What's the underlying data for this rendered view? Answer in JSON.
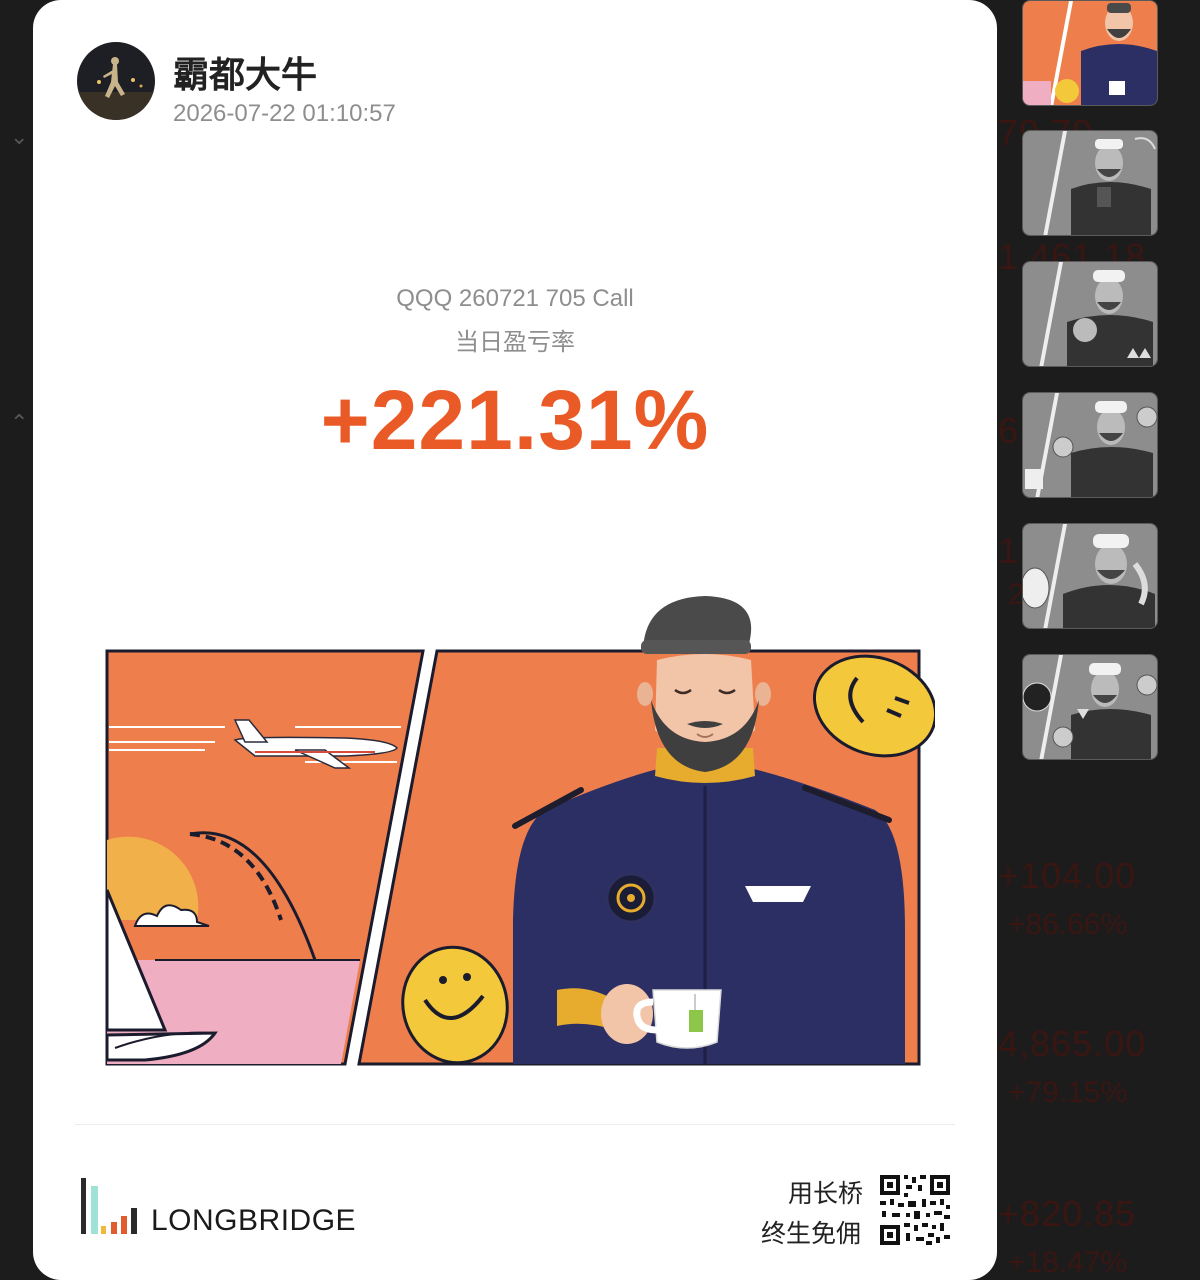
{
  "background": {
    "rows": [
      {
        "value": "79.79",
        "pct": ""
      },
      {
        "value": "1,461.18",
        "pct": ""
      },
      {
        "value": "6,",
        "pct": ""
      },
      {
        "value": "1,",
        "pct": "2"
      },
      {
        "value": "+104.00",
        "pct": "+86.66%"
      },
      {
        "value": "4,865.00",
        "pct": "+79.15%"
      },
      {
        "value": "+820.85",
        "pct": "+18.47%"
      }
    ]
  },
  "card": {
    "username": "霸都大牛",
    "timestamp": "2026-07-22 01:10:57",
    "contract": "QQQ 260721 705 Call",
    "metric_label": "当日盈亏率",
    "pnl_rate": "+221.31%",
    "brand": "LONGBRIDGE",
    "promo_line1": "用长桥",
    "promo_line2": "终生免佣"
  },
  "thumbnails": {
    "count": 6,
    "selected_index": 0
  },
  "colors": {
    "pnl_positive": "#ea5a26",
    "illustration_orange": "#ee7f4d",
    "background": "#1c1c1c",
    "card": "#ffffff"
  }
}
